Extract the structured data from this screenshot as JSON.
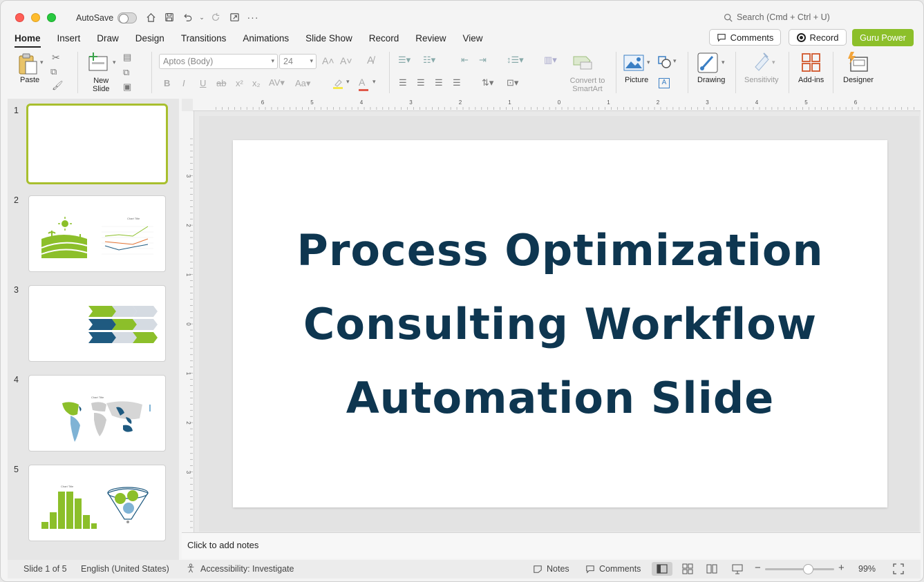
{
  "titlebar": {
    "autosave_label": "AutoSave",
    "search_placeholder": "Search (Cmd + Ctrl + U)"
  },
  "menu": {
    "tabs": [
      "Home",
      "Insert",
      "Draw",
      "Design",
      "Transitions",
      "Animations",
      "Slide Show",
      "Record",
      "Review",
      "View"
    ],
    "active_tab": "Home",
    "comments_label": "Comments",
    "record_label": "Record",
    "guru_label": "Guru Power"
  },
  "ribbon": {
    "paste": "Paste",
    "new_slide_line1": "New",
    "new_slide_line2": "Slide",
    "font_name": "Aptos (Body)",
    "font_size": "24",
    "convert_line1": "Convert to",
    "convert_line2": "SmartArt",
    "picture": "Picture",
    "drawing": "Drawing",
    "sensitivity": "Sensitivity",
    "addins": "Add-ins",
    "designer": "Designer"
  },
  "colors": {
    "accent_green": "#8cbf2a",
    "title_navy": "#0e3650",
    "selected_border": "#a8bf2e"
  },
  "slides": {
    "numbers": [
      "1",
      "2",
      "3",
      "4",
      "5"
    ]
  },
  "slide": {
    "title_line1": "Process Optimization",
    "title_line2": "Consulting Workflow",
    "title_line3": "Automation Slide"
  },
  "notes": {
    "placeholder": "Click to add notes"
  },
  "ruler": {
    "h_labels": [
      "6",
      "5",
      "4",
      "3",
      "2",
      "1",
      "0",
      "1",
      "2",
      "3",
      "4",
      "5",
      "6"
    ],
    "v_labels": [
      "3",
      "2",
      "1",
      "0",
      "1",
      "2",
      "3"
    ]
  },
  "status": {
    "slide_info": "Slide 1 of 5",
    "language": "English (United States)",
    "accessibility": "Accessibility: Investigate",
    "notes_label": "Notes",
    "comments_label": "Comments",
    "zoom": "99%",
    "zoom_fraction": 0.62
  }
}
